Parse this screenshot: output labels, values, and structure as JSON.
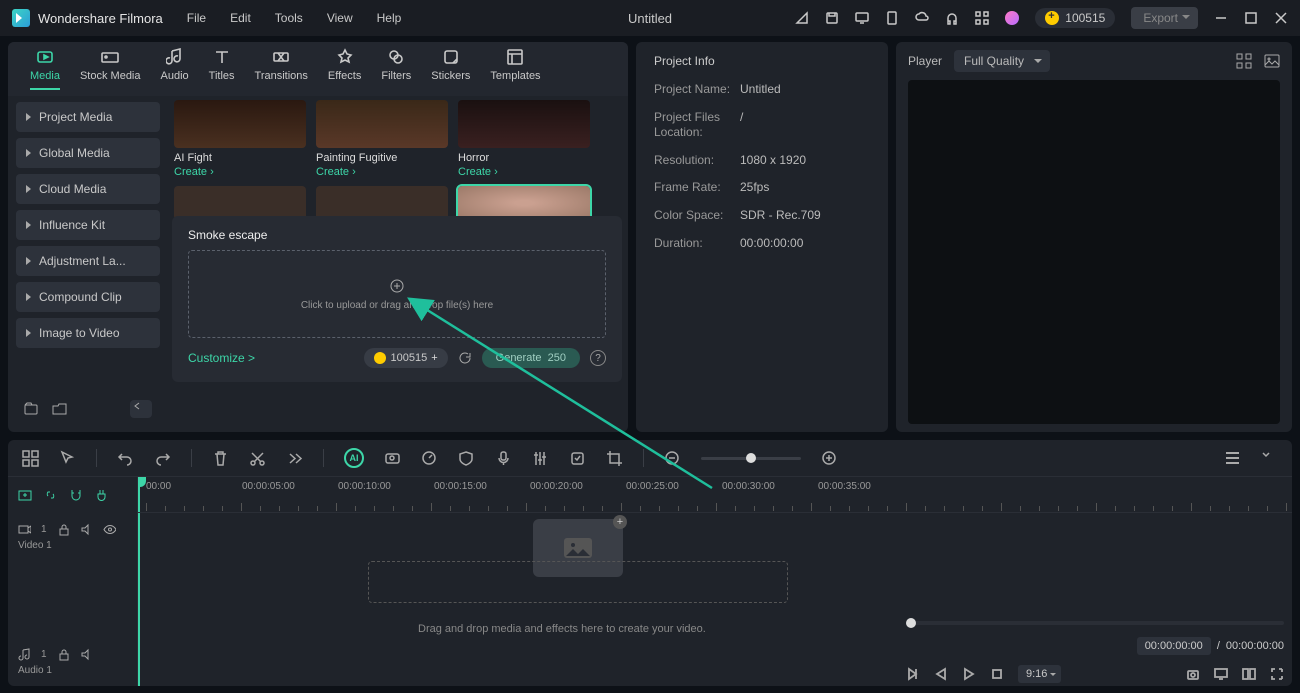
{
  "app_name": "Wondershare Filmora",
  "doc_title": "Untitled",
  "menu": [
    "File",
    "Edit",
    "Tools",
    "View",
    "Help"
  ],
  "credits": "100515",
  "export_label": "Export",
  "tabs": [
    {
      "label": "Media"
    },
    {
      "label": "Stock Media"
    },
    {
      "label": "Audio"
    },
    {
      "label": "Titles"
    },
    {
      "label": "Transitions"
    },
    {
      "label": "Effects"
    },
    {
      "label": "Filters"
    },
    {
      "label": "Stickers"
    },
    {
      "label": "Templates"
    }
  ],
  "sidebar": {
    "items": [
      "Project Media",
      "Global Media",
      "Cloud Media",
      "Influence Kit",
      "Adjustment La...",
      "Compound Clip",
      "Image to Video"
    ]
  },
  "thumbs": [
    {
      "title": "AI Fight",
      "create": "Create ›"
    },
    {
      "title": "Painting Fugitive",
      "create": "Create ›"
    },
    {
      "title": "Horror",
      "create": "Create ›"
    }
  ],
  "upload": {
    "title": "Smoke escape",
    "drop_text": "Click to upload or drag and drop file(s) here",
    "customize": "Customize >",
    "credits_pill": "100515",
    "generate": "Generate",
    "gen_cost": "250"
  },
  "project_info": {
    "header": "Project Info",
    "rows": [
      {
        "k": "Project Name:",
        "v": "Untitled"
      },
      {
        "k": "Project Files Location:",
        "v": "/"
      },
      {
        "k": "Resolution:",
        "v": "1080 x 1920"
      },
      {
        "k": "Frame Rate:",
        "v": "25fps"
      },
      {
        "k": "Color Space:",
        "v": "SDR - Rec.709"
      },
      {
        "k": "Duration:",
        "v": "00:00:00:00"
      }
    ]
  },
  "player": {
    "label": "Player",
    "quality": "Full Quality",
    "time_current": "00:00:00:00",
    "time_total": "00:00:00:00",
    "duration": "9:16"
  },
  "timeline": {
    "ruler": [
      "00:00",
      "00:00:05:00",
      "00:00:10:00",
      "00:00:15:00",
      "00:00:20:00",
      "00:00:25:00",
      "00:00:30:00",
      "00:00:35:00"
    ],
    "video_track": "Video 1",
    "audio_track": "Audio 1",
    "hint": "Drag and drop media and effects here to create your video."
  }
}
